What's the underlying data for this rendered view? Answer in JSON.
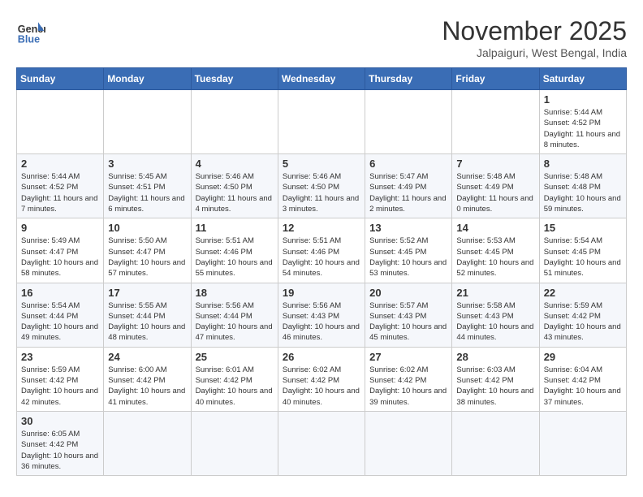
{
  "header": {
    "logo_general": "General",
    "logo_blue": "Blue",
    "month_title": "November 2025",
    "location": "Jalpaiguri, West Bengal, India"
  },
  "days_of_week": [
    "Sunday",
    "Monday",
    "Tuesday",
    "Wednesday",
    "Thursday",
    "Friday",
    "Saturday"
  ],
  "weeks": [
    [
      {
        "num": "",
        "info": ""
      },
      {
        "num": "",
        "info": ""
      },
      {
        "num": "",
        "info": ""
      },
      {
        "num": "",
        "info": ""
      },
      {
        "num": "",
        "info": ""
      },
      {
        "num": "",
        "info": ""
      },
      {
        "num": "1",
        "info": "Sunrise: 5:44 AM\nSunset: 4:52 PM\nDaylight: 11 hours\nand 8 minutes."
      }
    ],
    [
      {
        "num": "2",
        "info": "Sunrise: 5:44 AM\nSunset: 4:52 PM\nDaylight: 11 hours\nand 7 minutes."
      },
      {
        "num": "3",
        "info": "Sunrise: 5:45 AM\nSunset: 4:51 PM\nDaylight: 11 hours\nand 6 minutes."
      },
      {
        "num": "4",
        "info": "Sunrise: 5:46 AM\nSunset: 4:50 PM\nDaylight: 11 hours\nand 4 minutes."
      },
      {
        "num": "5",
        "info": "Sunrise: 5:46 AM\nSunset: 4:50 PM\nDaylight: 11 hours\nand 3 minutes."
      },
      {
        "num": "6",
        "info": "Sunrise: 5:47 AM\nSunset: 4:49 PM\nDaylight: 11 hours\nand 2 minutes."
      },
      {
        "num": "7",
        "info": "Sunrise: 5:48 AM\nSunset: 4:49 PM\nDaylight: 11 hours\nand 0 minutes."
      },
      {
        "num": "8",
        "info": "Sunrise: 5:48 AM\nSunset: 4:48 PM\nDaylight: 10 hours\nand 59 minutes."
      }
    ],
    [
      {
        "num": "9",
        "info": "Sunrise: 5:49 AM\nSunset: 4:47 PM\nDaylight: 10 hours\nand 58 minutes."
      },
      {
        "num": "10",
        "info": "Sunrise: 5:50 AM\nSunset: 4:47 PM\nDaylight: 10 hours\nand 57 minutes."
      },
      {
        "num": "11",
        "info": "Sunrise: 5:51 AM\nSunset: 4:46 PM\nDaylight: 10 hours\nand 55 minutes."
      },
      {
        "num": "12",
        "info": "Sunrise: 5:51 AM\nSunset: 4:46 PM\nDaylight: 10 hours\nand 54 minutes."
      },
      {
        "num": "13",
        "info": "Sunrise: 5:52 AM\nSunset: 4:45 PM\nDaylight: 10 hours\nand 53 minutes."
      },
      {
        "num": "14",
        "info": "Sunrise: 5:53 AM\nSunset: 4:45 PM\nDaylight: 10 hours\nand 52 minutes."
      },
      {
        "num": "15",
        "info": "Sunrise: 5:54 AM\nSunset: 4:45 PM\nDaylight: 10 hours\nand 51 minutes."
      }
    ],
    [
      {
        "num": "16",
        "info": "Sunrise: 5:54 AM\nSunset: 4:44 PM\nDaylight: 10 hours\nand 49 minutes."
      },
      {
        "num": "17",
        "info": "Sunrise: 5:55 AM\nSunset: 4:44 PM\nDaylight: 10 hours\nand 48 minutes."
      },
      {
        "num": "18",
        "info": "Sunrise: 5:56 AM\nSunset: 4:44 PM\nDaylight: 10 hours\nand 47 minutes."
      },
      {
        "num": "19",
        "info": "Sunrise: 5:56 AM\nSunset: 4:43 PM\nDaylight: 10 hours\nand 46 minutes."
      },
      {
        "num": "20",
        "info": "Sunrise: 5:57 AM\nSunset: 4:43 PM\nDaylight: 10 hours\nand 45 minutes."
      },
      {
        "num": "21",
        "info": "Sunrise: 5:58 AM\nSunset: 4:43 PM\nDaylight: 10 hours\nand 44 minutes."
      },
      {
        "num": "22",
        "info": "Sunrise: 5:59 AM\nSunset: 4:42 PM\nDaylight: 10 hours\nand 43 minutes."
      }
    ],
    [
      {
        "num": "23",
        "info": "Sunrise: 5:59 AM\nSunset: 4:42 PM\nDaylight: 10 hours\nand 42 minutes."
      },
      {
        "num": "24",
        "info": "Sunrise: 6:00 AM\nSunset: 4:42 PM\nDaylight: 10 hours\nand 41 minutes."
      },
      {
        "num": "25",
        "info": "Sunrise: 6:01 AM\nSunset: 4:42 PM\nDaylight: 10 hours\nand 40 minutes."
      },
      {
        "num": "26",
        "info": "Sunrise: 6:02 AM\nSunset: 4:42 PM\nDaylight: 10 hours\nand 40 minutes."
      },
      {
        "num": "27",
        "info": "Sunrise: 6:02 AM\nSunset: 4:42 PM\nDaylight: 10 hours\nand 39 minutes."
      },
      {
        "num": "28",
        "info": "Sunrise: 6:03 AM\nSunset: 4:42 PM\nDaylight: 10 hours\nand 38 minutes."
      },
      {
        "num": "29",
        "info": "Sunrise: 6:04 AM\nSunset: 4:42 PM\nDaylight: 10 hours\nand 37 minutes."
      }
    ],
    [
      {
        "num": "30",
        "info": "Sunrise: 6:05 AM\nSunset: 4:42 PM\nDaylight: 10 hours\nand 36 minutes."
      },
      {
        "num": "",
        "info": ""
      },
      {
        "num": "",
        "info": ""
      },
      {
        "num": "",
        "info": ""
      },
      {
        "num": "",
        "info": ""
      },
      {
        "num": "",
        "info": ""
      },
      {
        "num": "",
        "info": ""
      }
    ]
  ]
}
